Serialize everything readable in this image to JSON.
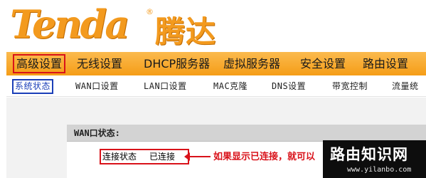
{
  "logo": {
    "text": "Tenda",
    "registered": "®",
    "chinese": "腾达"
  },
  "main_nav": {
    "items": [
      {
        "label": "高级设置",
        "active": true
      },
      {
        "label": "无线设置"
      },
      {
        "label": "DHCP服务器"
      },
      {
        "label": "虚拟服务器"
      },
      {
        "label": "安全设置"
      },
      {
        "label": "路由设置"
      }
    ]
  },
  "sub_nav": {
    "items": [
      {
        "label": "系统状态",
        "active": true
      },
      {
        "label": "WAN口设置"
      },
      {
        "label": "LAN口设置"
      },
      {
        "label": "MAC克隆"
      },
      {
        "label": "DNS设置"
      },
      {
        "label": "带宽控制"
      },
      {
        "label": "流量统"
      }
    ]
  },
  "wan_status": {
    "title": "WAN口状态:",
    "connection_label": "连接状态",
    "connection_value": "已连接"
  },
  "annotation": "如果显示已连接，就可以",
  "watermark": {
    "name": "路由知识网",
    "url": "www.yilanbo.com"
  },
  "colors": {
    "logo_orange": "#f39a1e",
    "nav_orange": "#f59d17",
    "highlight_red": "#d9121a",
    "highlight_blue": "#1b3fb8"
  }
}
